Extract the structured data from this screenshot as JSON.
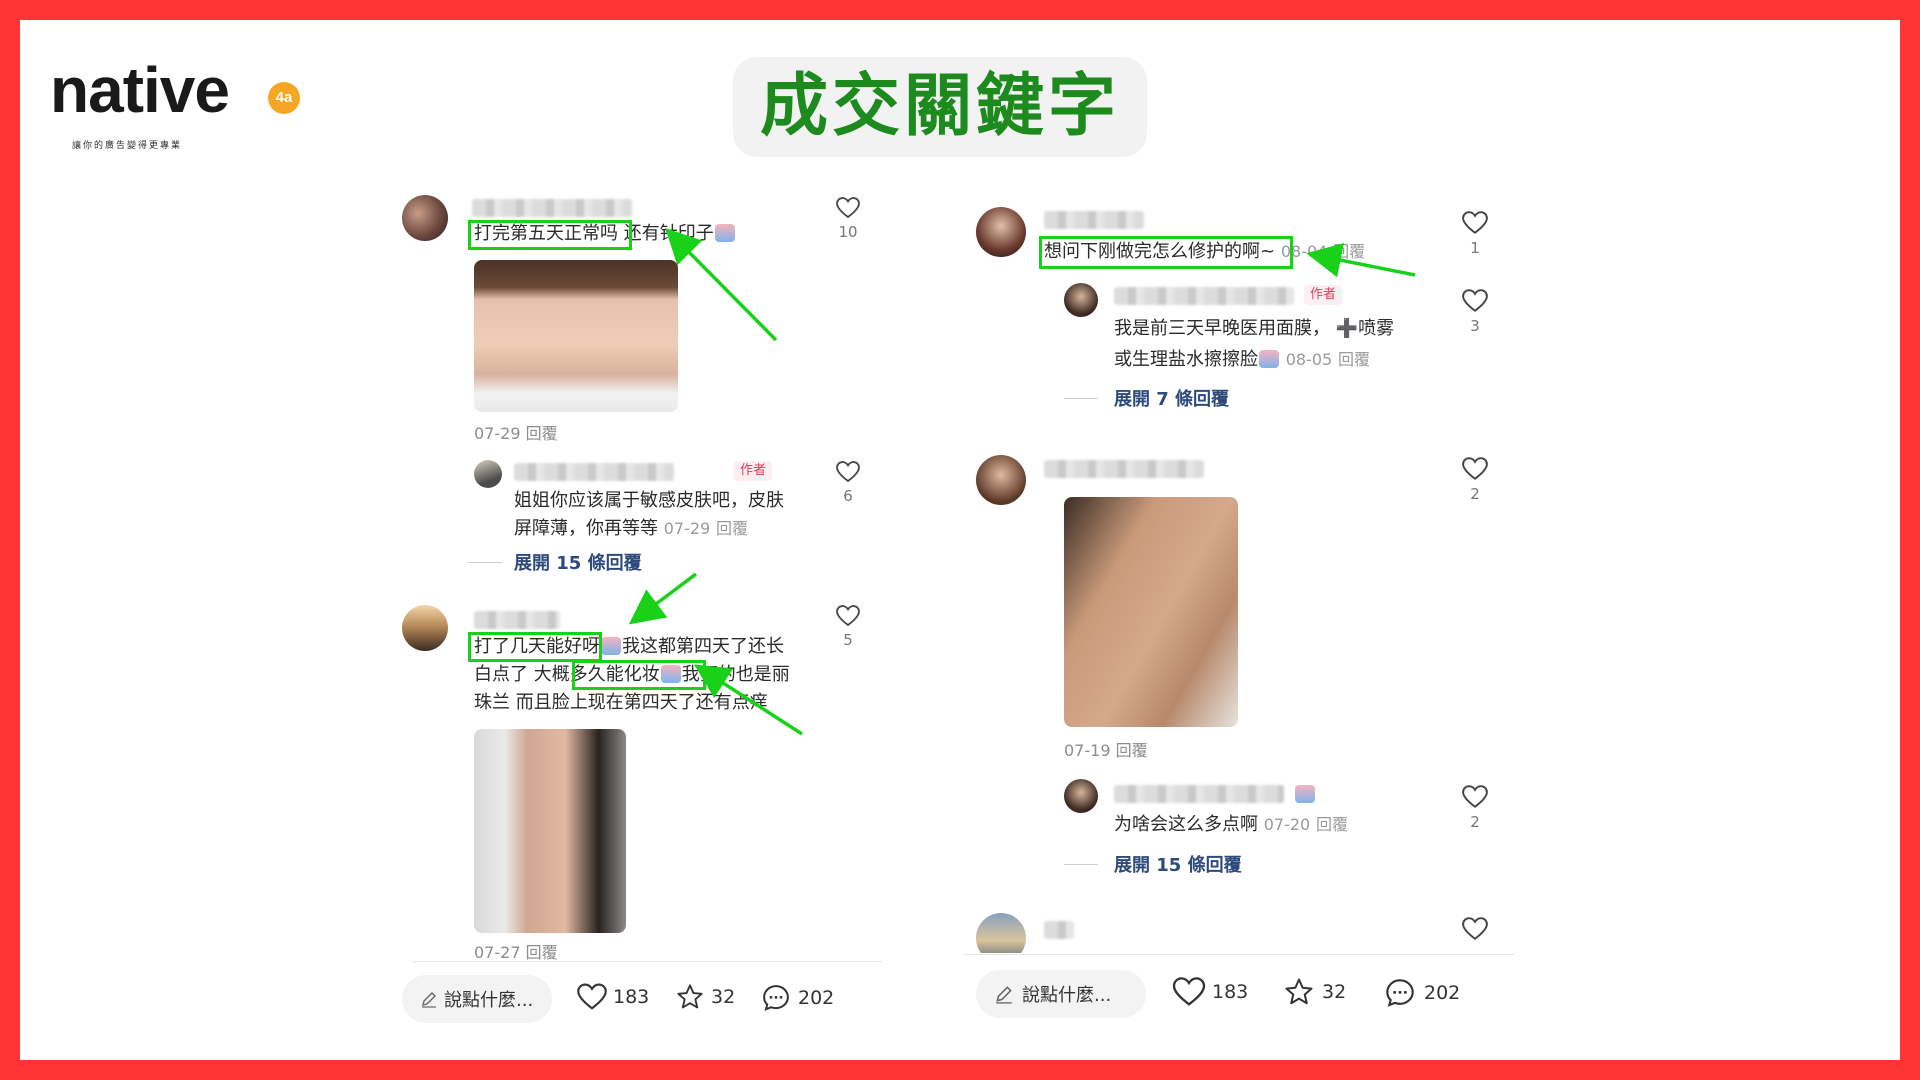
{
  "brand": {
    "wordmark": "native",
    "badge": "4a",
    "tagline": "讓你的廣告變得更專業"
  },
  "headline": "成交關鍵字",
  "colors": {
    "frame": "#ff3535",
    "highlight": "#19d119",
    "headline_text": "#1d8a1d",
    "author_tag": "#e03a5a"
  },
  "left_panel": {
    "comment1": {
      "pre": "打完第五天正常吗",
      "post": " 还有针印子",
      "date": "07-29",
      "reply": "回覆",
      "likes": "10"
    },
    "reply1": {
      "author_tag": "作者",
      "line1": "姐姐你应该属于敏感皮肤吧，皮肤",
      "line2": "屏障薄，你再等等",
      "date": "07-29",
      "reply": "回覆",
      "likes": "6",
      "expand": "展開 15 條回覆"
    },
    "comment2": {
      "hl1": "打了几天能好呀",
      "l1_rest": "我这都第四天了还长",
      "l2_pre": "白点了 ",
      "hl2": "大概多久能化妆",
      "l2_rest": "我打的也是丽",
      "line3": "珠兰 而且脸上现在第四天了还有点痒",
      "date": "07-27",
      "reply": "回覆",
      "likes": "5"
    },
    "bottom": {
      "say": "說點什麼...",
      "likes": "183",
      "stars": "32",
      "comments": "202"
    }
  },
  "right_panel": {
    "comment1": {
      "hl": "想问下刚做完怎么修护的啊",
      "suffix": "~",
      "date": "08-04",
      "reply": "回覆",
      "likes": "1"
    },
    "reply1": {
      "author_tag": "作者",
      "line1": "我是前三天早晚医用面膜， ➕喷雾",
      "line2": "或生理盐水擦擦脸",
      "date": "08-05",
      "reply": "回覆",
      "likes": "3",
      "expand": "展開 7 條回覆"
    },
    "comment2": {
      "date": "07-19",
      "reply": "回覆",
      "likes": "2"
    },
    "reply2": {
      "text": "为啥会这么多点啊",
      "date": "07-20",
      "reply": "回覆",
      "likes": "2",
      "expand": "展開 15 條回覆"
    },
    "bottom": {
      "say": "說點什麼...",
      "likes": "183",
      "stars": "32",
      "comments": "202"
    }
  }
}
